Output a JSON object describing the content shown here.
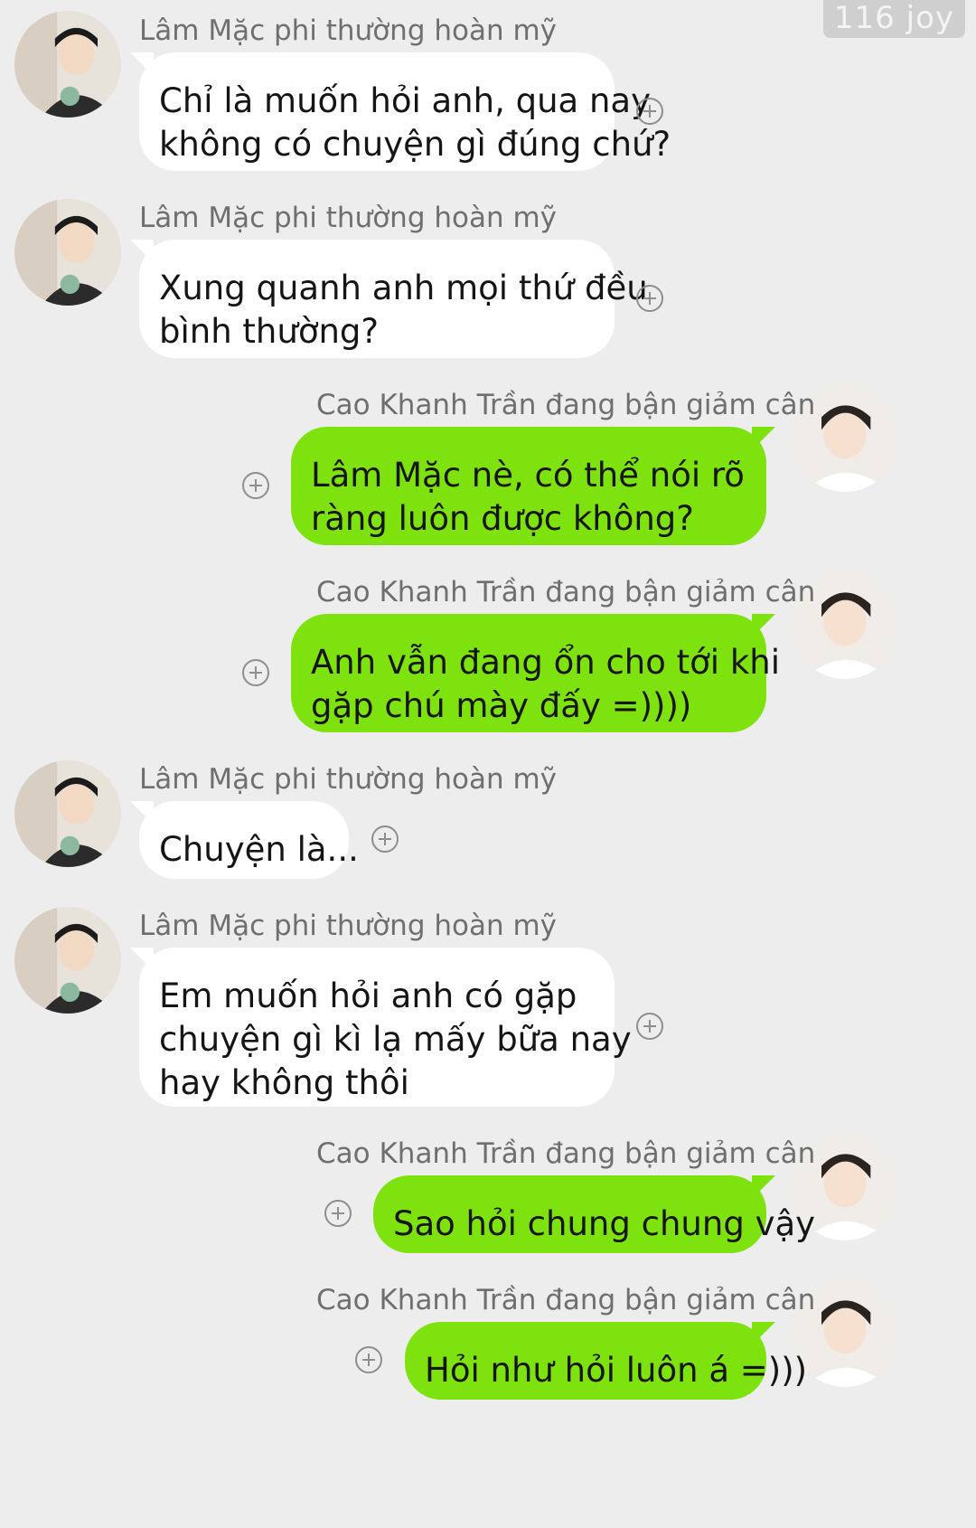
{
  "watermark": "116 joy",
  "contacts": {
    "other": "Lâm Mặc phi thường hoàn mỹ",
    "self": "Cao Khanh Trần đang bận giảm cân"
  },
  "messages": [
    {
      "sender": "other",
      "lines": [
        "Chỉ là muốn hỏi anh, qua nay",
        "không có chuyện gì đúng chứ?"
      ]
    },
    {
      "sender": "other",
      "lines": [
        "Xung quanh anh mọi thứ đều",
        "bình thường?"
      ]
    },
    {
      "sender": "self",
      "lines": [
        "Lâm Mặc nè, có thể nói rõ",
        "ràng luôn được không?"
      ]
    },
    {
      "sender": "self",
      "lines": [
        "Anh vẫn đang ổn cho tới khi",
        "gặp chú mày đấy =))))"
      ]
    },
    {
      "sender": "other",
      "lines": [
        "Chuyện là..."
      ]
    },
    {
      "sender": "other",
      "lines": [
        "Em muốn hỏi anh có gặp",
        "chuyện gì kì lạ mấy bữa nay",
        "hay không thôi"
      ]
    },
    {
      "sender": "self",
      "lines": [
        "Sao hỏi chung chung vậy"
      ]
    },
    {
      "sender": "self",
      "lines": [
        "Hỏi như hỏi luôn á =)))"
      ]
    }
  ],
  "icons": {
    "add": "plus-circle-icon",
    "avatar": "avatar"
  },
  "colors": {
    "background": "#ededed",
    "self_bubble": "#7ee20e",
    "other_bubble": "#ffffff",
    "name_text": "#6f6f6f"
  }
}
